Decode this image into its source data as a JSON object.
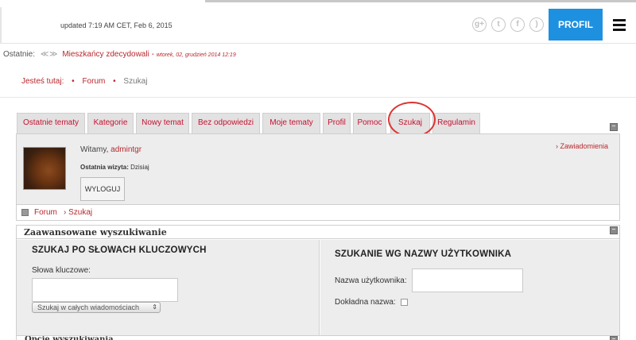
{
  "header": {
    "updated": "updated 7:19 AM CET, Feb 6, 2015",
    "social_icons": [
      "google-plus-icon",
      "twitter-icon",
      "facebook-icon",
      "rss-icon"
    ],
    "profil_button": "PROFIL",
    "menu_icon": "hamburger-menu-icon",
    "accent_color": "#1e90e0"
  },
  "latest": {
    "label": "Ostatnie:",
    "arrows": "≪ ≫",
    "title": "Mieszkańcy zdecydowali",
    "separator": " - ",
    "date": "wtorek, 02, grudzień 2014 12:19"
  },
  "breadcrumb": {
    "label": "Jesteś tutaj:",
    "bullet": "•",
    "forum": "Forum",
    "current": "Szukaj"
  },
  "tabs": [
    {
      "label": "Ostatnie tematy"
    },
    {
      "label": "Kategorie"
    },
    {
      "label": "Nowy temat"
    },
    {
      "label": "Bez odpowiedzi"
    },
    {
      "label": "Moje tematy"
    },
    {
      "label": "Profil"
    },
    {
      "label": "Pomoc"
    },
    {
      "label": "Szukaj"
    },
    {
      "label": "Regulamin"
    }
  ],
  "user": {
    "welcome": "Witamy, ",
    "username": "admintgr",
    "last_visit_label": "Ostatnia wizyta:",
    "last_visit_value": " Dzisiaj",
    "logout": "WYLOGUJ",
    "notifications": "› Zawiadomienia"
  },
  "forum_crumb": {
    "forum": "Forum",
    "search": "› Szukaj"
  },
  "advanced": {
    "title": "Zaawansowane wyszukiwanie",
    "keywords_heading": "SZUKAJ PO SŁOWACH KLUCZOWYCH",
    "keywords_label": "Słowa kluczowe:",
    "keywords_value": "",
    "search_scope": "Szukaj w całych wiadomościach",
    "username_heading": "SZUKANIE WG NAZWY UŻYTKOWNIKA",
    "username_label": "Nazwa użytkownika:",
    "username_value": "",
    "exact_label": "Dokładna nazwa:",
    "exact_checked": false,
    "next_section": "Opcje wyszukiwania"
  },
  "colors": {
    "link_red": "#b8282e",
    "highlight_circle": "#dd3333"
  }
}
